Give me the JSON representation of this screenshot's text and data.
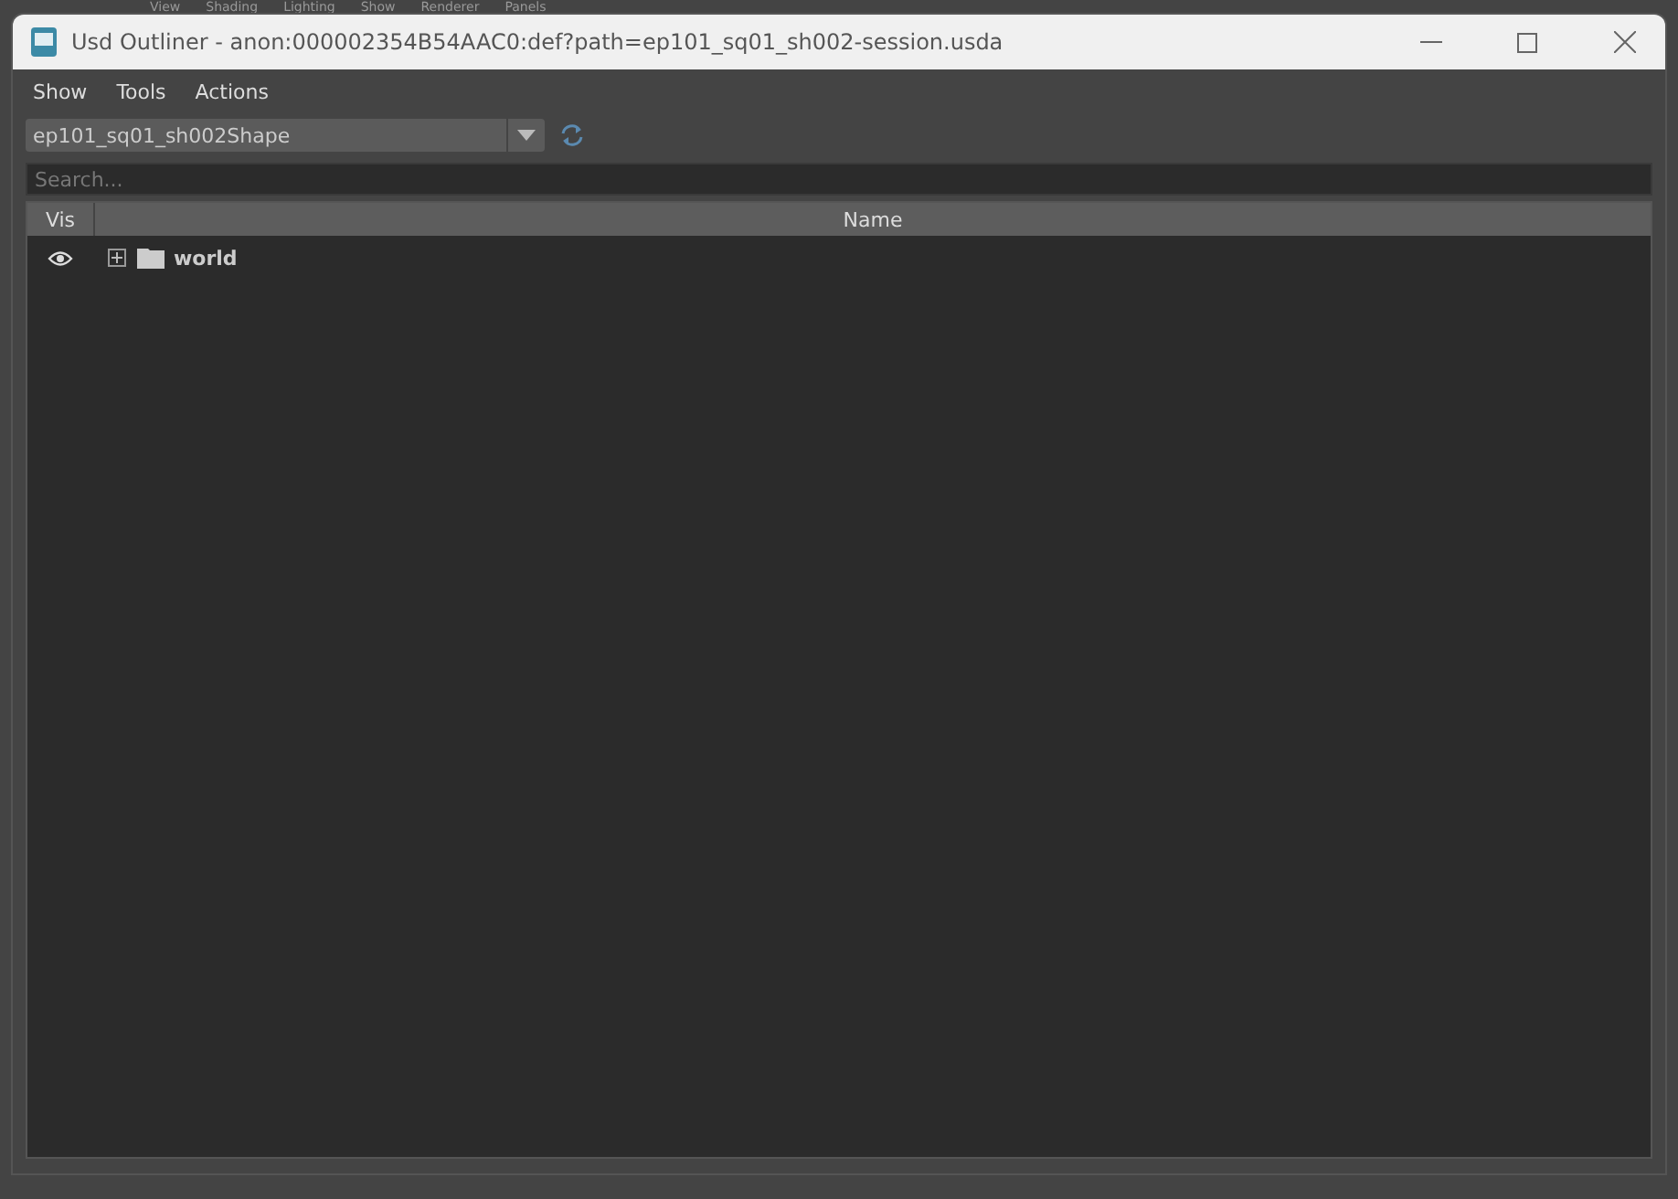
{
  "background_menu": [
    "View",
    "Shading",
    "Lighting",
    "Show",
    "Renderer",
    "Panels"
  ],
  "window": {
    "title": "Usd Outliner - anon:000002354B54AAC0:def?path=ep101_sq01_sh002-session.usda"
  },
  "menu": [
    "Show",
    "Tools",
    "Actions"
  ],
  "stage_selector": {
    "value": "ep101_sq01_sh002Shape"
  },
  "search": {
    "placeholder": "Search..."
  },
  "tree": {
    "columns": [
      "Vis",
      "Name"
    ],
    "items": [
      {
        "name": "world",
        "visible": true,
        "expanded": false
      }
    ]
  }
}
